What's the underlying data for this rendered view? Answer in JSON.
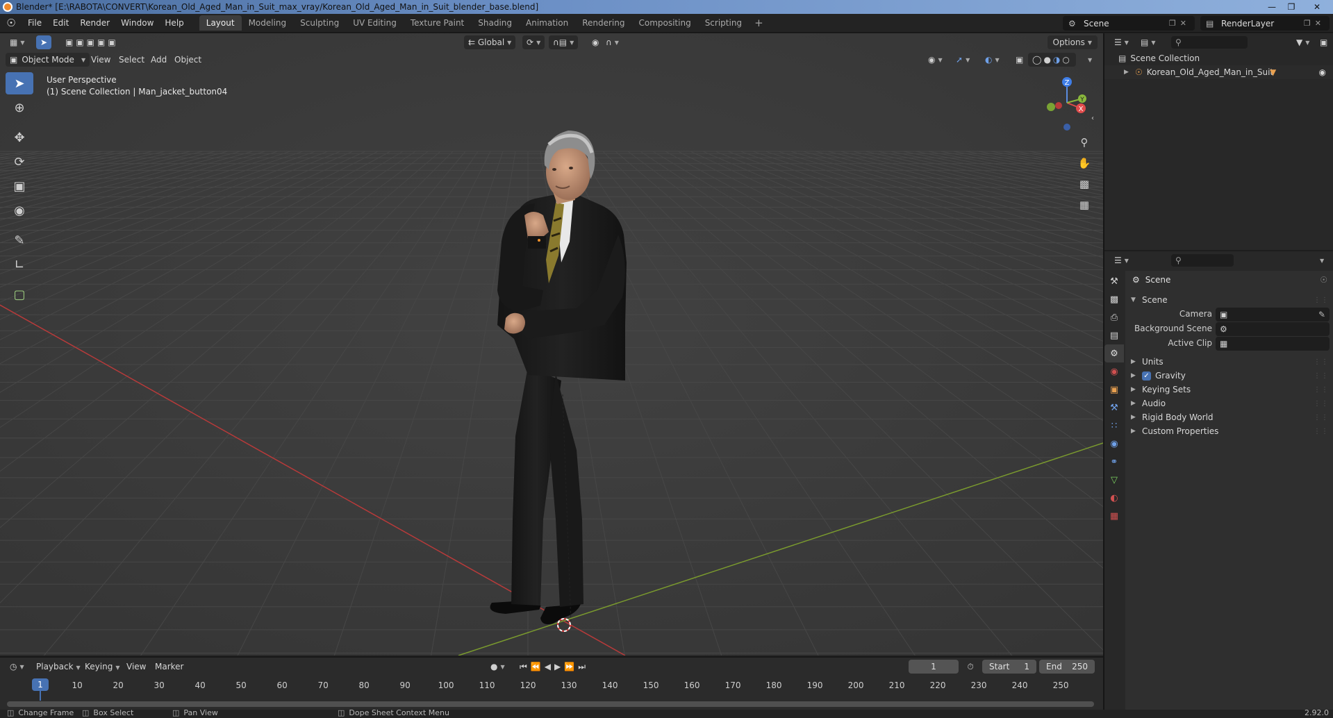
{
  "window": {
    "title": "Blender* [E:\\RABOTA\\CONVERT\\Korean_Old_Aged_Man_in_Suit_max_vray/Korean_Old_Aged_Man_in_Suit_blender_base.blend]",
    "minimize_icon": "minimize-icon",
    "maximize_icon": "maximize-icon",
    "close_icon": "close-icon"
  },
  "menubar": {
    "items": [
      "File",
      "Edit",
      "Render",
      "Window",
      "Help"
    ]
  },
  "workspaces": {
    "tabs": [
      "Layout",
      "Modeling",
      "Sculpting",
      "UV Editing",
      "Texture Paint",
      "Shading",
      "Animation",
      "Rendering",
      "Compositing",
      "Scripting"
    ],
    "active": "Layout",
    "add_label": "+"
  },
  "scene_selector": {
    "value": "Scene"
  },
  "renderlayer_selector": {
    "value": "RenderLayer"
  },
  "viewport": {
    "transform_orientation": "Global",
    "options_label": "Options",
    "mode": "Object Mode",
    "menus": [
      "View",
      "Select",
      "Add",
      "Object"
    ],
    "overlay_line1": "User Perspective",
    "overlay_line2": "(1) Scene Collection | Man_jacket_button04",
    "gizmo_axes": {
      "z": "Z",
      "y": "Y",
      "x": "X"
    },
    "colors": {
      "background": "#3b3b3b",
      "grid": "#474747",
      "x_axis": "#b83a3a",
      "y_axis": "#7a9a2e",
      "accent": "#4772b3"
    }
  },
  "timeline": {
    "menus": [
      "Playback",
      "Keying",
      "View",
      "Marker"
    ],
    "current_frame": "1",
    "start_label": "Start",
    "start_value": "1",
    "end_label": "End",
    "end_value": "250",
    "ticks": [
      "1",
      "10",
      "20",
      "30",
      "40",
      "50",
      "60",
      "70",
      "80",
      "90",
      "100",
      "110",
      "120",
      "130",
      "140",
      "150",
      "160",
      "170",
      "180",
      "190",
      "200",
      "210",
      "220",
      "230",
      "240",
      "250"
    ]
  },
  "statusbar": {
    "items": [
      "Change Frame",
      "Box Select",
      "Pan View",
      "Dope Sheet Context Menu"
    ],
    "version": "2.92.0"
  },
  "outliner": {
    "root": "Scene Collection",
    "items": [
      {
        "label": "Korean_Old_Aged_Man_in_Suit"
      }
    ]
  },
  "properties": {
    "context_title": "Scene",
    "panel_scene": "Scene",
    "fields": [
      {
        "label": "Camera"
      },
      {
        "label": "Background Scene"
      },
      {
        "label": "Active Clip"
      }
    ],
    "panels": [
      "Units",
      "Gravity",
      "Keying Sets",
      "Audio",
      "Rigid Body World",
      "Custom Properties"
    ],
    "gravity_checked": true
  }
}
